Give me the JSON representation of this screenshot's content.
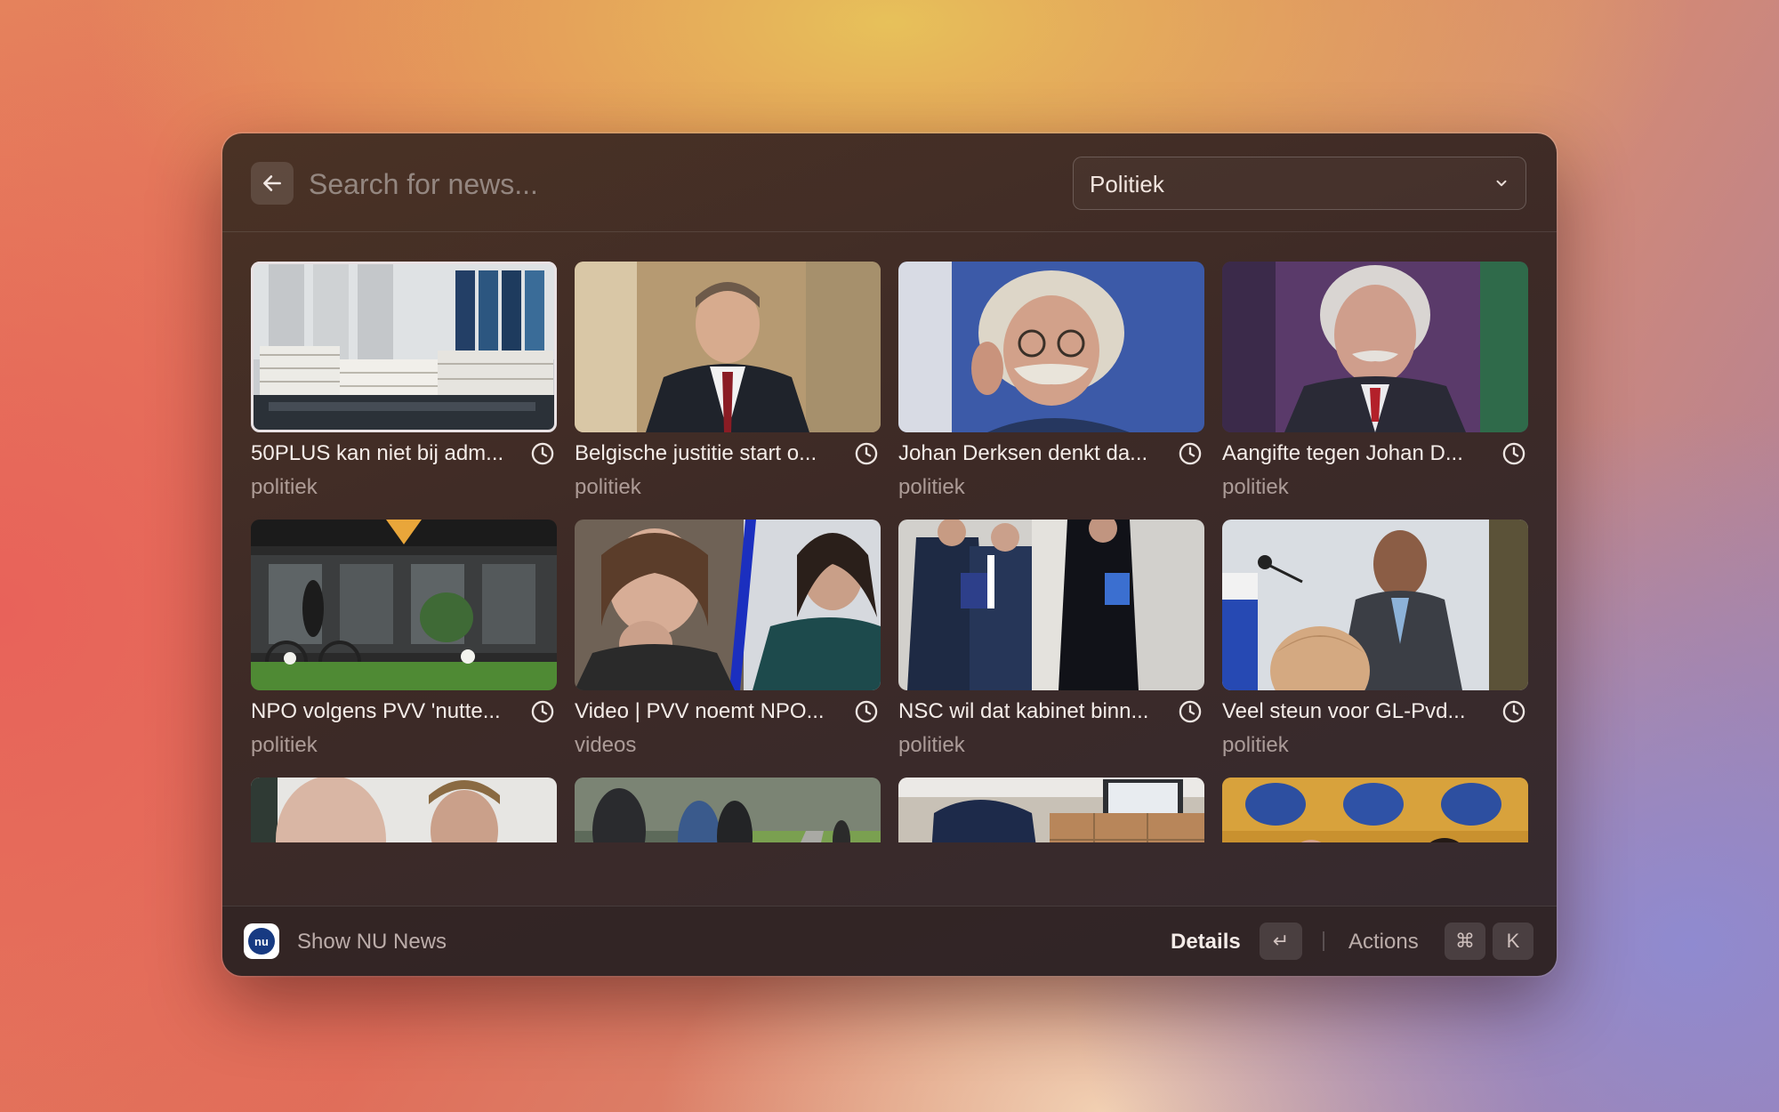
{
  "search": {
    "placeholder": "Search for news...",
    "value": ""
  },
  "category": {
    "selected": "Politiek"
  },
  "articles": [
    {
      "title": "50PLUS kan niet bij adm...",
      "category": "politiek",
      "selected": true
    },
    {
      "title": "Belgische justitie start o...",
      "category": "politiek"
    },
    {
      "title": "Johan Derksen denkt da...",
      "category": "politiek"
    },
    {
      "title": "Aangifte tegen Johan D...",
      "category": "politiek"
    },
    {
      "title": "NPO volgens PVV 'nutte...",
      "category": "politiek"
    },
    {
      "title": "Video | PVV noemt NPO...",
      "category": "videos"
    },
    {
      "title": "NSC wil dat kabinet binn...",
      "category": "politiek"
    },
    {
      "title": "Veel steun voor GL-Pvd...",
      "category": "politiek"
    },
    {
      "title": "",
      "category": ""
    },
    {
      "title": "",
      "category": ""
    },
    {
      "title": "",
      "category": ""
    },
    {
      "title": "",
      "category": ""
    }
  ],
  "footer": {
    "app_logo_text": "nu",
    "app_title": "Show NU News",
    "primary_action": "Details",
    "primary_key": "↵",
    "actions_label": "Actions",
    "actions_keys": [
      "⌘",
      "K"
    ]
  },
  "colors": {
    "window_bg": "#3d2a26",
    "text_primary": "#f4ece8",
    "nu_blue": "#173a82"
  },
  "icons": {
    "back": "arrow-left-icon",
    "dropdown": "chevron-down-icon",
    "article_time": "clock-icon"
  }
}
